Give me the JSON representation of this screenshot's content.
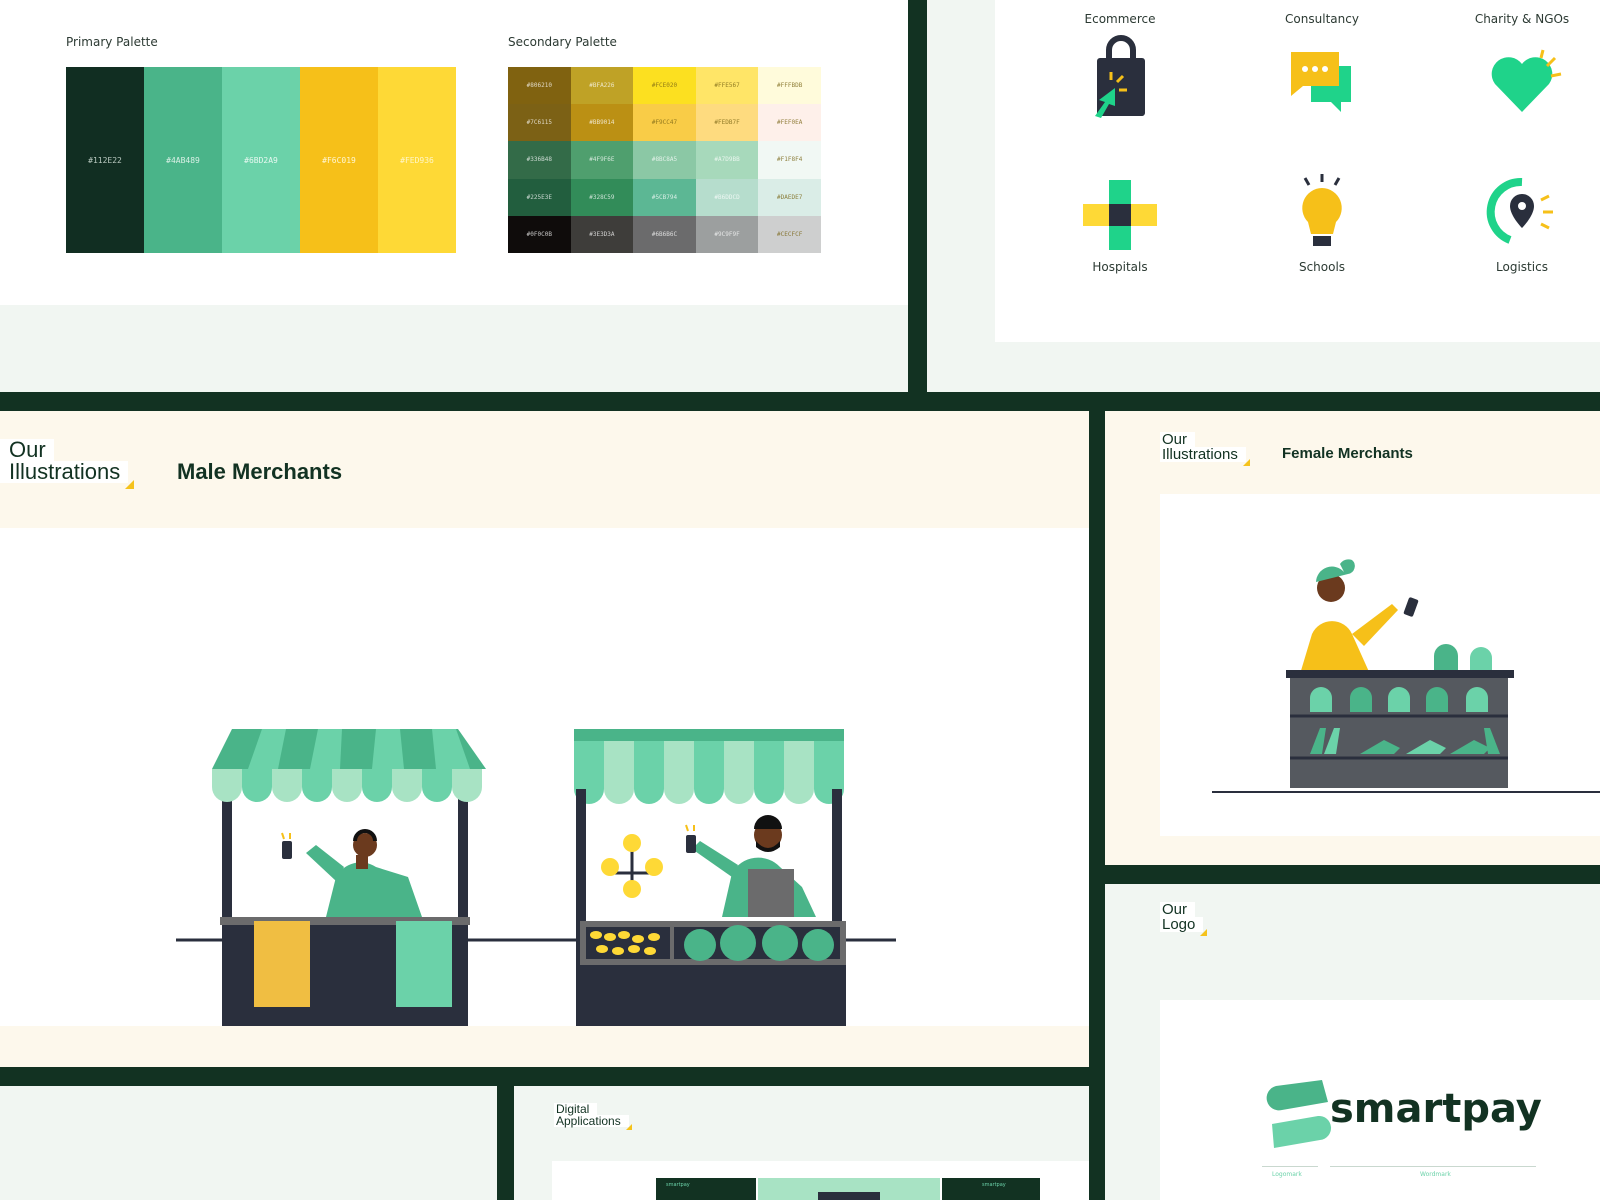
{
  "palette": {
    "primary_title": "Primary Palette",
    "secondary_title": "Secondary Palette",
    "primary": [
      {
        "hex": "#112E22",
        "label": "#112E22",
        "text": "#b7c7be"
      },
      {
        "hex": "#4AB489",
        "label": "#4AB489",
        "text": "#d8f0e5"
      },
      {
        "hex": "#6BD2A9",
        "label": "#6BD2A9",
        "text": "#e6f8f0"
      },
      {
        "hex": "#F6C019",
        "label": "#F6C019",
        "text": "#fff6d2"
      },
      {
        "hex": "#FED936",
        "label": "#FED936",
        "text": "#fff6c8"
      }
    ],
    "secondary": [
      [
        {
          "hex": "#806210",
          "label": "#806210"
        },
        {
          "hex": "#BFA226",
          "label": "#BFA226"
        },
        {
          "hex": "#FCE020",
          "label": "#FCE020"
        },
        {
          "hex": "#FFE567",
          "label": "#FFE567"
        },
        {
          "hex": "#FFFBDB",
          "label": "#FFFBDB"
        }
      ],
      [
        {
          "hex": "#7C6115",
          "label": "#7C6115"
        },
        {
          "hex": "#BB9014",
          "label": "#BB9014"
        },
        {
          "hex": "#F9CC47",
          "label": "#F9CC47"
        },
        {
          "hex": "#FEDB7F",
          "label": "#FEDB7F"
        },
        {
          "hex": "#FEF0EA",
          "label": "#FEF0EA"
        }
      ],
      [
        {
          "hex": "#336B48",
          "label": "#336B48"
        },
        {
          "hex": "#4F9F6E",
          "label": "#4F9F6E"
        },
        {
          "hex": "#8BC8A5",
          "label": "#8BC8A5"
        },
        {
          "hex": "#A7D9BB",
          "label": "#A7D9BB"
        },
        {
          "hex": "#F1F8F4",
          "label": "#F1F8F4"
        }
      ],
      [
        {
          "hex": "#225E3E",
          "label": "#225E3E"
        },
        {
          "hex": "#328C59",
          "label": "#328C59"
        },
        {
          "hex": "#5CB794",
          "label": "#5CB794"
        },
        {
          "hex": "#B6DDCD",
          "label": "#B6DDCD"
        },
        {
          "hex": "#DAEDE7",
          "label": "#DAEDE7"
        }
      ],
      [
        {
          "hex": "#0F0C0B",
          "label": "#0F0C0B"
        },
        {
          "hex": "#3E3D3A",
          "label": "#3E3D3A"
        },
        {
          "hex": "#6B6B6C",
          "label": "#6B6B6C"
        },
        {
          "hex": "#9C9F9F",
          "label": "#9C9F9F"
        },
        {
          "hex": "#CECFCF",
          "label": "#CECFCF"
        }
      ]
    ]
  },
  "categories": [
    {
      "name": "Ecommerce",
      "icon": "shopping-bag-icon"
    },
    {
      "name": "Consultancy",
      "icon": "chat-bubbles-icon"
    },
    {
      "name": "Charity & NGOs",
      "icon": "heart-icon"
    },
    {
      "name": "Hospitals",
      "icon": "medical-cross-icon"
    },
    {
      "name": "Schools",
      "icon": "light-bulb-icon"
    },
    {
      "name": "Logistics",
      "icon": "location-pin-icon"
    }
  ],
  "male_section": {
    "tag_our": "Our",
    "tag_word": "Illustrations",
    "title": "Male Merchants"
  },
  "female_section": {
    "tag_our": "Our",
    "tag_word": "Illustrations",
    "title": "Female Merchants"
  },
  "logo_section": {
    "tag_our": "Our",
    "tag_word": "Logo",
    "brand": "smartpay",
    "logomark_caption": "Logomark",
    "wordmark_caption": "Wordmark"
  },
  "digital_section": {
    "tag_top": "Digital",
    "tag_word": "Applications",
    "app_brand": "smartpay"
  },
  "colors": {
    "dark": "#123222",
    "green": "#4AB489",
    "mint": "#6BD2A9",
    "yellow": "#F6C019",
    "navy": "#2a2f3d"
  }
}
